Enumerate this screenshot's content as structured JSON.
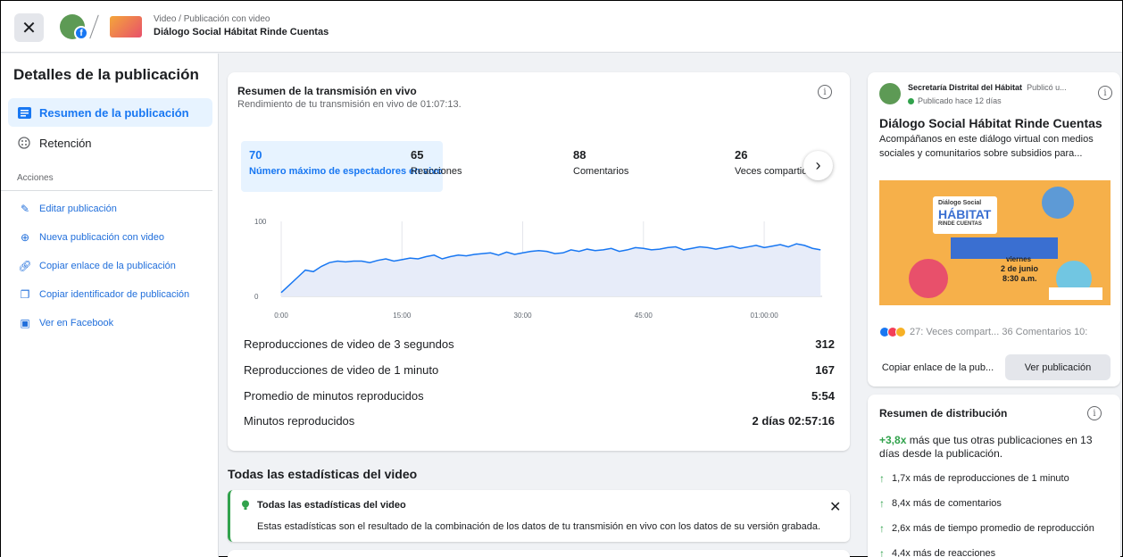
{
  "header": {
    "close_icon": "close-icon",
    "breadcrumb_sub": "Video / Publicación con video",
    "breadcrumb_title": "Diálogo Social Hábitat Rinde Cuentas"
  },
  "sidebar": {
    "title": "Detalles de la publicación",
    "nav": [
      {
        "label": "Resumen de la publicación",
        "icon": "list-icon",
        "active": true
      },
      {
        "label": "Retención",
        "icon": "retention-icon",
        "active": false
      }
    ],
    "actions_label": "Acciones",
    "actions": [
      {
        "label": "Editar publicación",
        "icon": "pencil-icon"
      },
      {
        "label": "Nueva publicación con video",
        "icon": "plus-circle-icon"
      },
      {
        "label": "Copiar enlace de la publicación",
        "icon": "link-icon"
      },
      {
        "label": "Copiar identificador de publicación",
        "icon": "copy-icon"
      },
      {
        "label": "Ver en Facebook",
        "icon": "facebook-window-icon"
      }
    ]
  },
  "live_summary": {
    "title": "Resumen de la transmisión en vivo",
    "subtitle": "Rendimiento de tu transmisión en vivo de 01:07:13.",
    "metrics": [
      {
        "value": "70",
        "label": "Número máximo de espectadores en vivo",
        "selected": true
      },
      {
        "value": "65",
        "label": "Reacciones",
        "selected": false
      },
      {
        "value": "88",
        "label": "Comentarios",
        "selected": false
      },
      {
        "value": "26",
        "label": "Veces compartido",
        "selected": false
      }
    ],
    "stats": [
      {
        "label": "Reproducciones de video de 3 segundos",
        "value": "312"
      },
      {
        "label": "Reproducciones de video de 1 minuto",
        "value": "167"
      },
      {
        "label": "Promedio de minutos reproducidos",
        "value": "5:54"
      },
      {
        "label": "Minutos reproducidos",
        "value": "2 días 02:57:16"
      }
    ]
  },
  "chart_data": {
    "type": "area",
    "x_tick_labels": [
      "0:00",
      "15:00",
      "30:00",
      "45:00",
      "01:00:00"
    ],
    "y_tick_labels": [
      "0",
      "100"
    ],
    "ylim": [
      0,
      100
    ],
    "xlim": [
      0,
      67.2
    ],
    "series": [
      {
        "x": [
          0,
          1,
          2,
          3,
          4,
          5,
          6,
          7,
          8,
          9,
          10,
          11,
          12,
          13,
          14,
          15,
          16,
          17,
          18,
          19,
          20,
          21,
          22,
          23,
          24,
          25,
          26,
          27,
          28,
          29,
          30,
          31,
          32,
          33,
          34,
          35,
          36,
          37,
          38,
          39,
          40,
          41,
          42,
          43,
          44,
          45,
          46,
          47,
          48,
          49,
          50,
          51,
          52,
          53,
          54,
          55,
          56,
          57,
          58,
          59,
          60,
          61,
          62,
          63,
          64,
          65,
          66,
          67
        ],
        "y": [
          5,
          15,
          25,
          35,
          33,
          40,
          45,
          47,
          46,
          47,
          47,
          45,
          48,
          50,
          47,
          49,
          51,
          50,
          53,
          55,
          50,
          53,
          55,
          54,
          56,
          57,
          58,
          55,
          59,
          56,
          58,
          60,
          61,
          60,
          57,
          58,
          62,
          60,
          63,
          61,
          62,
          64,
          60,
          62,
          65,
          64,
          62,
          63,
          65,
          66,
          62,
          64,
          66,
          65,
          63,
          65,
          67,
          64,
          66,
          68,
          65,
          67,
          69,
          66,
          70,
          68,
          64,
          62
        ]
      }
    ],
    "color": "#1877f2",
    "fill": "#e7ecf9",
    "grid": true
  },
  "stats_section": {
    "heading": "Todas las estadísticas del video",
    "tip_title": "Todas las estadísticas del video",
    "tip_body": "Estas estadísticas son el resultado de la combinación de los datos de tu transmisión en vivo con los datos de su versión grabada."
  },
  "post_preview": {
    "page_name": "Secretaría Distrital del Hábitat",
    "published_by": "Publicó u...",
    "status": "Publicado hace 12 días",
    "title": "Diálogo Social Hábitat Rinde Cuentas",
    "description": "Acompáñanos en este diálogo virtual con medios sociales y comunitarios sobre subsidios para...",
    "reactions_count": "27:",
    "shares": "Veces compart...",
    "comments": "36  Comentarios 10:",
    "copy_link": "Copiar enlace de la pub...",
    "view_post": "Ver publicación",
    "image_text": {
      "line1": "Diálogo Social",
      "line2": "HÁBITAT",
      "line3": "RINDE CUENTAS",
      "day": "viernes",
      "date": "2 de junio",
      "time": "8:30 a.m."
    }
  },
  "distribution": {
    "title": "Resumen de distribución",
    "lead_highlight": "+3,8x",
    "lead_rest": " más que tus otras publicaciones en 13 días desde la publicación.",
    "items": [
      "1,7x más de reproducciones de 1 minuto",
      "8,4x más de comentarios",
      "2,6x más de tiempo promedio de reproducción",
      "4,4x más de reacciones"
    ]
  }
}
